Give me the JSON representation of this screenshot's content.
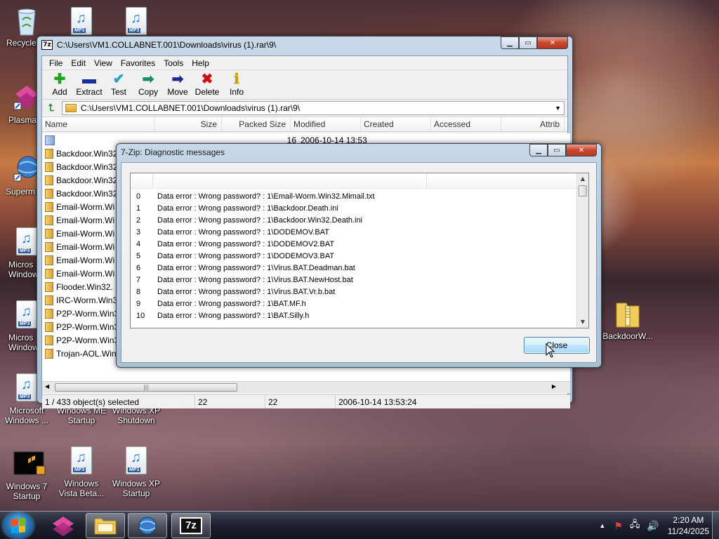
{
  "desktop": {
    "icons": [
      {
        "label": "Recycle",
        "kind": "recycle-bin"
      },
      {
        "label": "Plasma",
        "kind": "plasma-app"
      },
      {
        "label": "Superm",
        "kind": "browser-globe"
      },
      {
        "label": "Micros\nWindow",
        "kind": "mp3"
      },
      {
        "label": "Micros\nWindow",
        "kind": "mp3"
      },
      {
        "label": "Microsoft Windows ...",
        "kind": "mp3"
      },
      {
        "label": "Windows ME Startup",
        "kind": "mp3"
      },
      {
        "label": "Windows XP Shutdown",
        "kind": "mp3"
      },
      {
        "label": "Windows 7 Startup",
        "kind": "video"
      },
      {
        "label": "Windows Vista Beta...",
        "kind": "mp3"
      },
      {
        "label": "Windows XP Startup",
        "kind": "mp3"
      },
      {
        "label": "BackdoorW...",
        "kind": "zip-folder"
      }
    ]
  },
  "main_window": {
    "title": "C:\\Users\\VM1.COLLABNET.001\\Downloads\\virus (1).rar\\9\\",
    "menu": [
      "File",
      "Edit",
      "View",
      "Favorites",
      "Tools",
      "Help"
    ],
    "toolbar": [
      {
        "label": "Add",
        "icon": "plus-icon",
        "color": "#1fa31f"
      },
      {
        "label": "Extract",
        "icon": "minus-icon",
        "color": "#1a2fa0"
      },
      {
        "label": "Test",
        "icon": "check-icon",
        "color": "#2aa0c0"
      },
      {
        "label": "Copy",
        "icon": "copy-arrow-icon",
        "color": "#1a8a6a"
      },
      {
        "label": "Move",
        "icon": "move-arrow-icon",
        "color": "#1a2a90"
      },
      {
        "label": "Delete",
        "icon": "delete-x-icon",
        "color": "#d01010"
      },
      {
        "label": "Info",
        "icon": "info-icon",
        "color": "#c8a000"
      }
    ],
    "address": "C:\\Users\\VM1.COLLABNET.001\\Downloads\\virus (1).rar\\9\\",
    "columns": [
      "Name",
      "Size",
      "Packed Size",
      "Modified",
      "Created",
      "Accessed",
      "Attrib"
    ],
    "first_row": {
      "size": "",
      "packed": "16",
      "modified": "2006-10-14 13:53"
    },
    "files": [
      "Backdoor.Win32",
      "Backdoor.Win32",
      "Backdoor.Win32",
      "Backdoor.Win32",
      "Email-Worm.Wi",
      "Email-Worm.Wi",
      "Email-Worm.Wi",
      "Email-Worm.Wi",
      "Email-Worm.Wi",
      "Email-Worm.Wi",
      "Flooder.Win32.",
      "IRC-Worm.Win3",
      "P2P-Worm.Win3",
      "P2P-Worm.Win3",
      "P2P-Worm.Win3",
      "Trojan-AOL.Win1"
    ],
    "status": {
      "selected": "1 / 433 object(s) selected",
      "size": "22",
      "packed": "22",
      "modified": "2006-10-14 13:53:24"
    }
  },
  "dialog": {
    "title": "7-Zip: Diagnostic messages",
    "messages": [
      {
        "idx": "0",
        "text": "Data error : Wrong password? : 1\\Email-Worm.Win32.Mimail.txt"
      },
      {
        "idx": "1",
        "text": "Data error : Wrong password? : 1\\Backdoor.Death.ini"
      },
      {
        "idx": "2",
        "text": "Data error : Wrong password? : 1\\Backdoor.Win32.Death.ini"
      },
      {
        "idx": "3",
        "text": "Data error : Wrong password? : 1\\DODEMOV.BAT"
      },
      {
        "idx": "4",
        "text": "Data error : Wrong password? : 1\\DODEMOV2.BAT"
      },
      {
        "idx": "5",
        "text": "Data error : Wrong password? : 1\\DODEMOV3.BAT"
      },
      {
        "idx": "6",
        "text": "Data error : Wrong password? : 1\\Virus.BAT.Deadman.bat"
      },
      {
        "idx": "7",
        "text": "Data error : Wrong password? : 1\\Virus.BAT.NewHost.bat"
      },
      {
        "idx": "8",
        "text": "Data error : Wrong password? : 1\\Virus.BAT.Vr.b.bat"
      },
      {
        "idx": "9",
        "text": "Data error : Wrong password? : 1\\BAT.MF.h"
      },
      {
        "idx": "10",
        "text": "Data error : Wrong password? : 1\\BAT.Silly.h"
      }
    ],
    "close_label": "Close"
  },
  "taskbar": {
    "time": "2:20 AM",
    "date": "11/24/2025",
    "items": [
      "plasma-app",
      "file-explorer",
      "browser-globe",
      "7zip"
    ]
  }
}
